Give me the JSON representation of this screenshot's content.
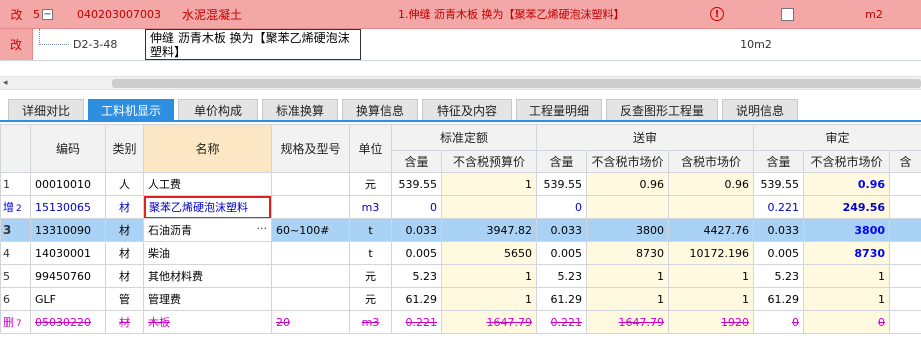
{
  "top_rows": {
    "row1": {
      "mark": "改",
      "index": "5",
      "code": "040203007003",
      "name": "水泥混凝土",
      "desc": "1.伸缝 沥青木板  换为【聚苯乙烯硬泡沫塑料】",
      "unit": "m2",
      "warn_symbol": "!"
    },
    "row2": {
      "mark": "改",
      "code": "D2-3-48",
      "name": "伸缝 沥青木板  换为【聚苯乙烯硬泡沫塑料】",
      "unit": "10m2"
    }
  },
  "scroll": {
    "left_arrow": "◂"
  },
  "tabs": [
    "详细对比",
    "工料机显示",
    "单价构成",
    "标准换算",
    "换算信息",
    "特征及内容",
    "工程量明细",
    "反查图形工程量",
    "说明信息"
  ],
  "active_tab": "工料机显示",
  "grid": {
    "headers": {
      "code": "编码",
      "type": "类别",
      "name": "名称",
      "spec": "规格及型号",
      "unit": "单位",
      "group_standard": "标准定额",
      "group_send": "送审",
      "group_approve": "审定",
      "qty": "含量",
      "budget_price_ex_tax": "不含税预算价",
      "market_price_ex_tax": "不含税市场价",
      "market_price_inc_tax": "含税市场价"
    },
    "rows": [
      {
        "mark": "",
        "idx": "1",
        "code": "00010010",
        "type": "人",
        "name": "人工费",
        "spec": "",
        "unit": "元",
        "std_qty": "539.55",
        "std_price": "1",
        "send_qty": "539.55",
        "send_ex": "0.96",
        "send_inc": "0.96",
        "app_qty": "539.55",
        "app_ex": "0.96"
      },
      {
        "mark": "增",
        "idx": "2",
        "code": "15130065",
        "type": "材",
        "name": "聚苯乙烯硬泡沫塑料",
        "spec": "",
        "unit": "m3",
        "std_qty": "0",
        "std_price": "",
        "send_qty": "0",
        "send_ex": "",
        "send_inc": "",
        "app_qty": "0.221",
        "app_ex": "249.56"
      },
      {
        "mark": "",
        "idx": "3",
        "code": "13310090",
        "type": "材",
        "name": "石油沥青",
        "spec": "60~100#",
        "unit": "t",
        "std_qty": "0.033",
        "std_price": "3947.82",
        "send_qty": "0.033",
        "send_ex": "3800",
        "send_inc": "4427.76",
        "app_qty": "0.033",
        "app_ex": "3800",
        "ellipsis": "···"
      },
      {
        "mark": "",
        "idx": "4",
        "code": "14030001",
        "type": "材",
        "name": "柴油",
        "spec": "",
        "unit": "t",
        "std_qty": "0.005",
        "std_price": "5650",
        "send_qty": "0.005",
        "send_ex": "8730",
        "send_inc": "10172.196",
        "app_qty": "0.005",
        "app_ex": "8730"
      },
      {
        "mark": "",
        "idx": "5",
        "code": "99450760",
        "type": "材",
        "name": "其他材料费",
        "spec": "",
        "unit": "元",
        "std_qty": "5.23",
        "std_price": "1",
        "send_qty": "5.23",
        "send_ex": "1",
        "send_inc": "1",
        "app_qty": "5.23",
        "app_ex": "1"
      },
      {
        "mark": "",
        "idx": "6",
        "code": "GLF",
        "type": "管",
        "name": "管理费",
        "spec": "",
        "unit": "元",
        "std_qty": "61.29",
        "std_price": "1",
        "send_qty": "61.29",
        "send_ex": "1",
        "send_inc": "1",
        "app_qty": "61.29",
        "app_ex": "1"
      },
      {
        "mark": "删",
        "idx": "7",
        "code": "05030220",
        "type": "材",
        "name": "木板",
        "spec": "20",
        "unit": "m3",
        "std_qty": "0.221",
        "std_price": "1647.79",
        "send_qty": "0.221",
        "send_ex": "1647.79",
        "send_inc": "1920",
        "app_qty": "0",
        "app_ex": "0"
      }
    ]
  },
  "colors": {
    "changed_row": "#f4a7a7",
    "selected_row": "#a9d2f4",
    "added_text": "#0000c8",
    "deleted_text": "#d000d0",
    "tab_active": "#2e8fe0",
    "highlight_box": "#e02020"
  }
}
